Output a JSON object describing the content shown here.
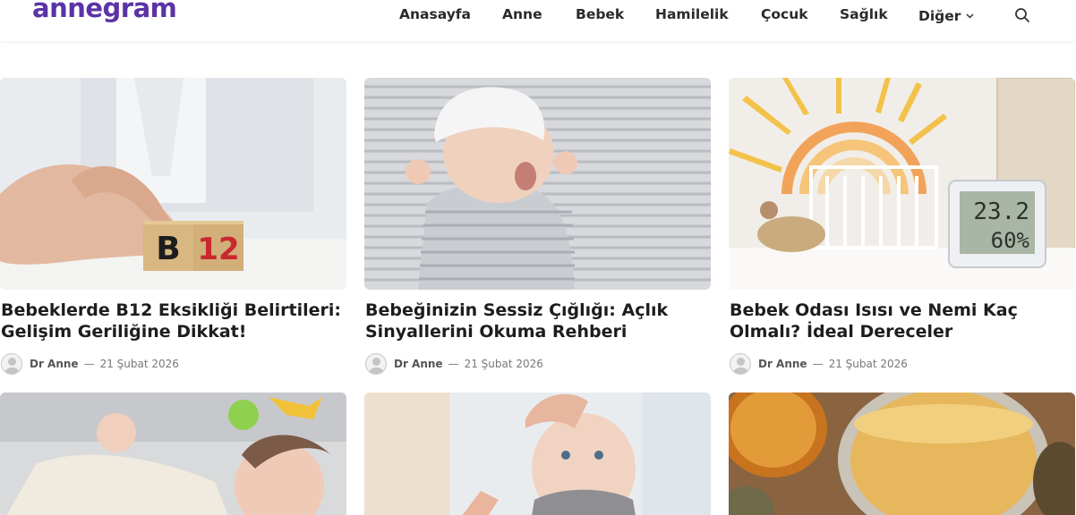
{
  "header": {
    "logo": "annegram",
    "nav": [
      {
        "label": "Anasayfa"
      },
      {
        "label": "Anne"
      },
      {
        "label": "Bebek"
      },
      {
        "label": "Hamilelik"
      },
      {
        "label": "Çocuk"
      },
      {
        "label": "Sağlık"
      },
      {
        "label": "Diğer"
      }
    ],
    "search_icon": "search-icon",
    "more_icon": "chevron-down-icon"
  },
  "colors": {
    "brand": "#5b33a6",
    "text": "#1d1d1d",
    "meta": "#777777"
  },
  "posts": [
    {
      "title": "Bebeklerde B12 Eksikliği Belirtileri: Gelişim Geriliğine Dikkat!",
      "author": "Dr Anne",
      "separator": "—",
      "date": "21 Şubat 2026",
      "image_text": "B12"
    },
    {
      "title": "Bebeğinizin Sessiz Çığlığı: Açlık Sinyallerini Okuma Rehberi",
      "author": "Dr Anne",
      "separator": "—",
      "date": "21 Şubat 2026"
    },
    {
      "title": "Bebek Odası Isısı ve Nemi Kaç Olmalı? İdeal Dereceler",
      "author": "Dr Anne",
      "separator": "—",
      "date": "21 Şubat 2026",
      "image_text_1": "23.2",
      "image_text_2": "60%"
    },
    {
      "title": ""
    },
    {
      "title": ""
    },
    {
      "title": ""
    }
  ]
}
